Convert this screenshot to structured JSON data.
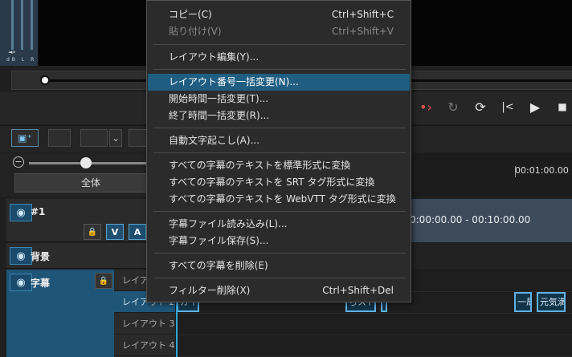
{
  "meter": {
    "labels": "dB L R",
    "speaker": "◄»"
  },
  "controls": {
    "mark": "•›",
    "redo": "↻",
    "loop": "⟳",
    "prev": "|<",
    "play": "▶",
    "stop": "■"
  },
  "toolbar": {
    "add_icon": "▣⁺",
    "dropdown": "⌄"
  },
  "zoom": {
    "minus": "−",
    "all_label": "全体"
  },
  "ruler": {
    "time": "00:01:00.00"
  },
  "tracks": {
    "track1": {
      "label": "#1",
      "v": "V",
      "a": "A",
      "clip_text": "0:00:00.00 - 00:10:00.00"
    },
    "background": {
      "label": "背景"
    },
    "subtitles": {
      "label": "字幕"
    }
  },
  "layouts": [
    "レイア",
    "レイアウト 2",
    "レイアウト 3",
    "レイアウト 4"
  ],
  "subclips": [
    "ガイ",
    "ちスト",
    "一局",
    "元気満"
  ],
  "menu": {
    "copy": {
      "label": "コピー(C)",
      "shortcut": "Ctrl+Shift+C"
    },
    "paste": {
      "label": "貼り付け(V)",
      "shortcut": "Ctrl+Shift+V"
    },
    "layout_edit": {
      "label": "レイアウト編集(Y)..."
    },
    "layout_number_bulk": {
      "label": "レイアウト番号一括変更(N)..."
    },
    "start_time_bulk": {
      "label": "開始時間一括変更(T)..."
    },
    "end_time_bulk": {
      "label": "終了時間一括変更(R)..."
    },
    "auto_transcribe": {
      "label": "自動文字起こし(A)..."
    },
    "to_standard": {
      "label": "すべての字幕のテキストを標準形式に変換"
    },
    "to_srt": {
      "label": "すべての字幕のテキストを SRT タグ形式に変換"
    },
    "to_webvtt": {
      "label": "すべての字幕のテキストを WebVTT タグ形式に変換"
    },
    "load_file": {
      "label": "字幕ファイル読み込み(L)..."
    },
    "save_file": {
      "label": "字幕ファイル保存(S)..."
    },
    "delete_all": {
      "label": "すべての字幕を削除(E)"
    },
    "remove_filter": {
      "label": "フィルター削除(X)",
      "shortcut": "Ctrl+Shift+Del"
    }
  }
}
